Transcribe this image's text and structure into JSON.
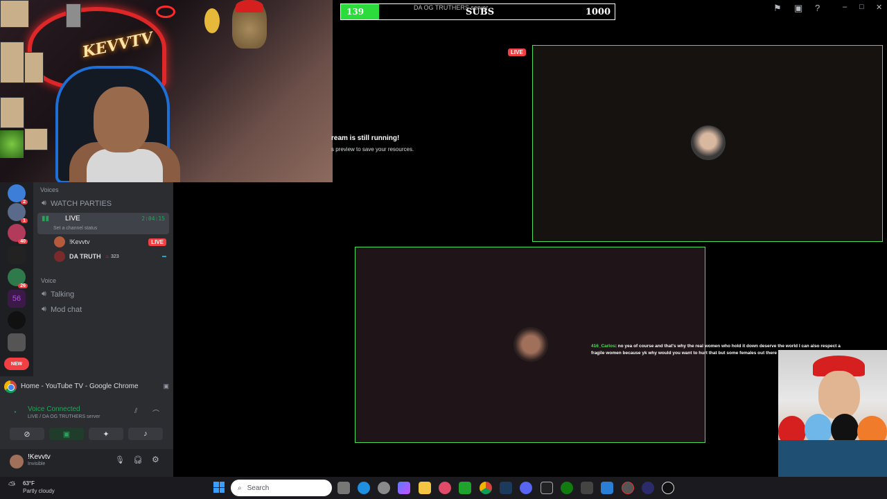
{
  "webcam": {
    "neon_text": "KEVVTV"
  },
  "subs_bar": {
    "current": "139",
    "label": "SUBS",
    "goal": "1000",
    "server_tag": "DA OG TRUTHERS server",
    "progress": 0.139
  },
  "stream_notice": {
    "title": "ream is still running!",
    "subtitle": "s preview to save your resources."
  },
  "stream_live_badge": "LIVE",
  "chat_overlay": {
    "user": "416_Carlos",
    "message": ": no yea of course and that's why the real women who hold it down deserve the world I can also respect a fragile women because yk why would you want to hurt that but some females out there dudes"
  },
  "discord": {
    "servers": [
      {
        "badge": "2"
      },
      {
        "badge": "1"
      },
      {
        "badge": "40"
      },
      {
        "badge": ""
      },
      {
        "badge": "26"
      },
      {
        "badge": ""
      },
      {
        "badge": ""
      },
      {
        "badge": ""
      }
    ],
    "new_label": "NEW",
    "voices_category": "Voices",
    "watch_parties": "WATCH PARTIES",
    "live_channel": {
      "name": "LIVE",
      "timer": "2:04:15",
      "status": "Set a channel status"
    },
    "members": [
      {
        "name": "!Kevvtv",
        "badge": "LIVE"
      },
      {
        "name": "DA TRUTH",
        "extra": "323"
      }
    ],
    "voice_category": "Voice",
    "channels": [
      "Talking",
      "Mod chat"
    ],
    "activity": {
      "title": "Home - YouTube TV - Google Chrome"
    },
    "voice_connected": {
      "status": "Voice Connected",
      "location": "LIVE / DA OG TRUTHERS server"
    },
    "user": {
      "name": "!Kevvtv",
      "status": "Invisible"
    }
  },
  "taskbar": {
    "weather_temp": "63°F",
    "weather_desc": "Partly cloudy",
    "search_placeholder": "Search"
  },
  "colors": {
    "accent_green": "#2bdc3c",
    "live_red": "#f23f43",
    "panel_border": "#4be05b"
  }
}
